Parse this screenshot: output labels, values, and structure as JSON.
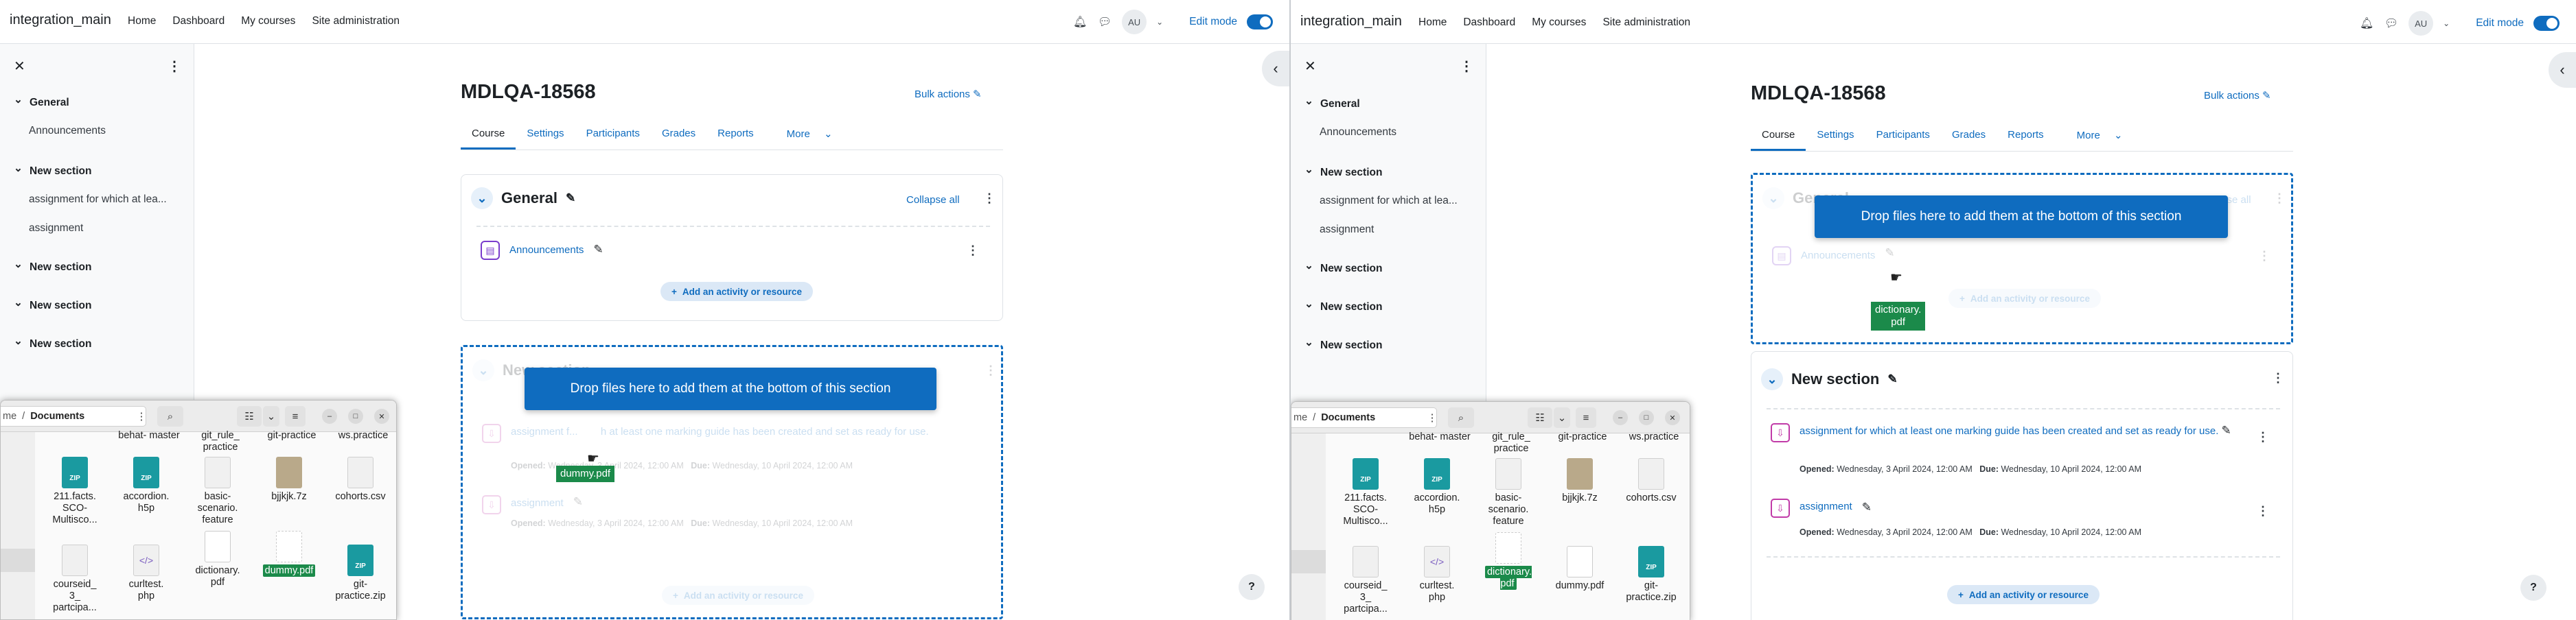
{
  "site_name": "integration_main",
  "primary_nav": [
    "Home",
    "Dashboard",
    "My courses",
    "Site administration"
  ],
  "user_initials": "AU",
  "edit_mode_label": "Edit mode",
  "course_index": {
    "sections": [
      {
        "title": "General",
        "items": [
          "Announcements"
        ]
      },
      {
        "title": "New section",
        "items": [
          "assignment for which at lea...",
          "assignment"
        ]
      },
      {
        "title": "New section",
        "items": []
      },
      {
        "title": "New section",
        "items": []
      },
      {
        "title": "New section",
        "items": []
      }
    ]
  },
  "course": {
    "title": "MDLQA-18568",
    "bulk_actions": "Bulk actions",
    "tabs": [
      "Course",
      "Settings",
      "Participants",
      "Grades",
      "Reports",
      "More"
    ],
    "active_tab": "Course",
    "collapse_all": "Collapse all",
    "general_title": "General",
    "announcements": "Announcements",
    "add_activity": "Add an activity or resource",
    "new_section_title": "New section",
    "assignment_long": "assignment for which at least one marking guide has been created and set as ready for use.",
    "assignment_long_left": "assignment f...",
    "assignment_long_left_tail": "h at least one marking guide has been created and set as ready for use.",
    "assignment_short": "assignment",
    "opened_label": "Opened:",
    "opened_value": "Wednesday, 3 April 2024, 12:00 AM",
    "due_label": "Due:",
    "due_value": "Wednesday, 10 April 2024, 12:00 AM",
    "drop_message": "Drop files here to add them at the bottom of this section"
  },
  "drag": {
    "left_file": "dummy.pdf",
    "right_file_line1": "dictionary.",
    "right_file_line2": "pdf"
  },
  "help_label": "?",
  "file_manager": {
    "breadcrumb_prefix": "me",
    "breadcrumb_current": "Documents",
    "top_partial": [
      "behat-\nmaster",
      "git_rule_\npractice",
      "git-practice",
      "ws.practice"
    ],
    "row1": [
      {
        "name": "211.facts.\nSCO-\nMultisco...",
        "type": "zip"
      },
      {
        "name": "accordion.\nh5p",
        "type": "zip"
      },
      {
        "name": "basic-\nscenario.\nfeature",
        "type": "doc"
      },
      {
        "name": "bjjkjk.7z",
        "type": "sevenz"
      },
      {
        "name": "cohorts.csv",
        "type": "doc"
      }
    ],
    "row2": [
      {
        "name": "courseid_\n3_\npartcipa...",
        "type": "doc"
      },
      {
        "name": "curltest.\nphp",
        "type": "code"
      },
      {
        "name": "dictionary.\npdf",
        "type": "pdf"
      },
      {
        "name": "dummy.pdf",
        "type": "pdf"
      },
      {
        "name": "git-\npractice.zip",
        "type": "zip"
      }
    ],
    "selected_left": "dummy.pdf",
    "selected_right": "dictionary.pdf"
  },
  "colors": {
    "accent": "#0f6cbf",
    "drop_green": "#1b8a4a",
    "assign_pink": "#c13ba8",
    "forum_purple": "#7a3dcc"
  },
  "icons": [
    "bell-icon",
    "chat-icon",
    "pencil-icon",
    "kebab-icon",
    "close-icon",
    "chevron-down-icon",
    "chevron-left-icon",
    "help-icon",
    "assignment-icon",
    "forum-icon",
    "folder-icon"
  ]
}
